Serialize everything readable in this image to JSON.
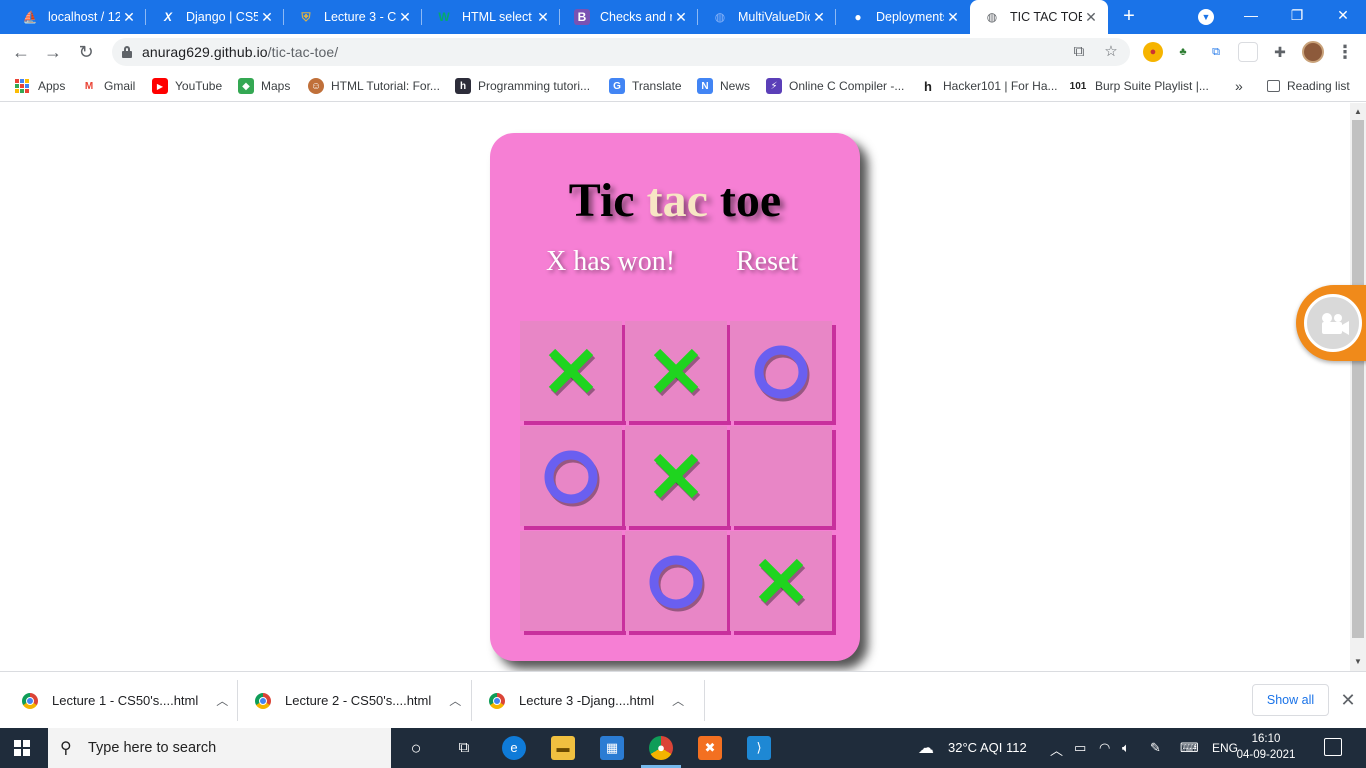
{
  "tabs": [
    {
      "title": "localhost / 12",
      "favicon": "phpmyadmin-icon",
      "glyph": "⛵",
      "color": "#f0a020"
    },
    {
      "title": "Django | CS50",
      "favicon": "x-logo-icon",
      "glyph": "X",
      "color": "#ffffff"
    },
    {
      "title": "Lecture 3 - CS",
      "favicon": "harvard-shield-icon",
      "glyph": "⛨",
      "color": "#d9b14a"
    },
    {
      "title": "HTML select t",
      "favicon": "w3schools-icon",
      "glyph": "W",
      "color": "#04aa6d"
    },
    {
      "title": "Checks and ra",
      "favicon": "bootstrap-icon",
      "glyph": "B",
      "color": "#7952b3"
    },
    {
      "title": "MultiValueDic",
      "favicon": "globe-icon",
      "glyph": "◍",
      "color": "#8ab4f8"
    },
    {
      "title": "Deployments",
      "favicon": "github-icon",
      "glyph": "●",
      "color": "#ffffff"
    },
    {
      "title": "TIC TAC TOE",
      "favicon": "globe-icon",
      "glyph": "◍",
      "color": "#5f6368",
      "active": true
    }
  ],
  "address": {
    "domain": "anurag629.github.io",
    "path": "/tic-tac-toe/"
  },
  "bookmarks": [
    {
      "label": "Apps",
      "icon": "apps-grid-icon"
    },
    {
      "label": "Gmail",
      "icon": "gmail-icon",
      "glyph": "M",
      "color": "#ea4335"
    },
    {
      "label": "YouTube",
      "icon": "youtube-icon",
      "glyph": "▶",
      "color": "#ff0000"
    },
    {
      "label": "Maps",
      "icon": "maps-icon",
      "glyph": "◆",
      "color": "#34a853"
    },
    {
      "label": "HTML Tutorial: For...",
      "icon": "tutorial-avatar-icon",
      "glyph": "☺",
      "color": "#c0703a"
    },
    {
      "label": "Programming tutori...",
      "icon": "hashnode-icon",
      "glyph": "h",
      "color": "#2d2d3a"
    },
    {
      "label": "Translate",
      "icon": "translate-icon",
      "glyph": "G",
      "color": "#4285f4"
    },
    {
      "label": "News",
      "icon": "news-icon",
      "glyph": "N",
      "color": "#4285f4"
    },
    {
      "label": "Online C Compiler -...",
      "icon": "compiler-icon",
      "glyph": "⚡",
      "color": "#5b3fb8"
    },
    {
      "label": "Hacker101 | For Ha...",
      "icon": "hacker101-icon",
      "glyph": "h",
      "color": "#222222"
    },
    {
      "label": "Burp Suite Playlist |...",
      "icon": "burp-101-icon",
      "glyph": "101",
      "color": "#222222"
    },
    {
      "label": "»",
      "icon": "more-bookmarks-icon"
    },
    {
      "label": "Reading list",
      "icon": "reading-list-icon"
    }
  ],
  "game": {
    "title_a": "Tic ",
    "title_b": "tac",
    "title_c": " toe",
    "status": "X has won!",
    "reset_label": "Reset",
    "x_color": "#1fd41f",
    "o_color": "#6a5ff0",
    "board": [
      "X",
      "X",
      "O",
      "O",
      "X",
      "",
      "",
      "O",
      "X"
    ]
  },
  "downloads": [
    {
      "name": "Lecture 1 - CS50's....html"
    },
    {
      "name": "Lecture 2 - CS50's....html"
    },
    {
      "name": "Lecture 3 -Djang....html"
    }
  ],
  "shelf": {
    "show_all": "Show all",
    "close": "✕"
  },
  "taskbar": {
    "search_placeholder": "Type here to search",
    "weather": "32°C  AQI 112",
    "language": "ENG",
    "time": "16:10",
    "date": "04-09-2021"
  }
}
